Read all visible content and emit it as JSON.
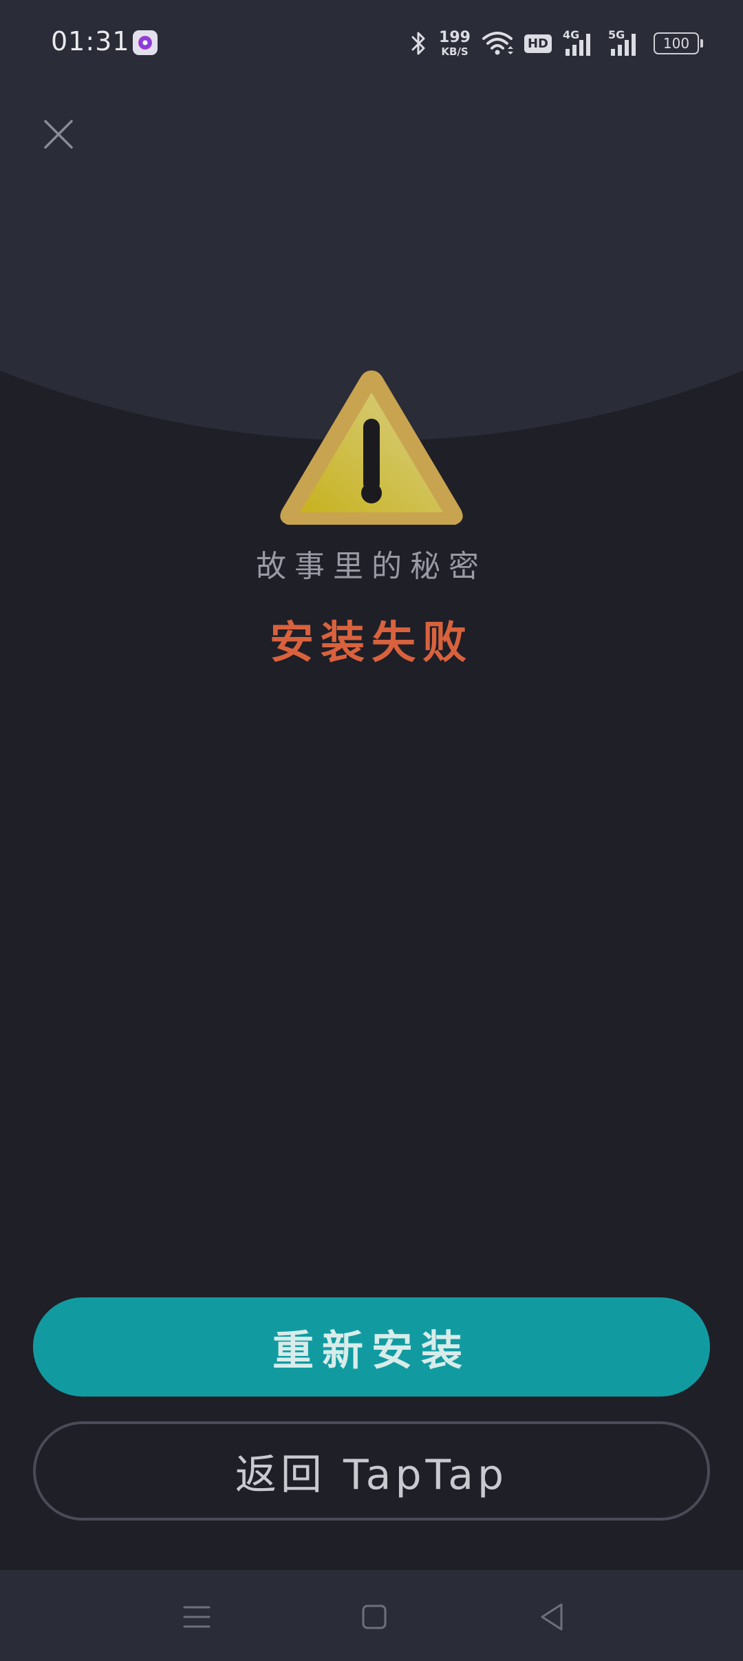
{
  "status_bar": {
    "time": "01:31",
    "net_speed_value": "199",
    "net_speed_unit": "KB/S",
    "hd_label": "HD",
    "network_1": "4G",
    "network_2": "5G",
    "battery": "100",
    "icons": [
      "app-notification-icon",
      "bluetooth-icon",
      "wifi-icon",
      "hd-icon",
      "signal-4g-icon",
      "signal-5g-icon",
      "battery-icon"
    ]
  },
  "header": {
    "close_icon": "close-icon"
  },
  "main": {
    "warning_icon": "warning-triangle-icon",
    "game_name": "故事里的秘密",
    "status_title": "安装失败"
  },
  "actions": {
    "reinstall_label": "重新安装",
    "back_label": "返回 TapTap"
  },
  "nav_bar": {
    "icons": [
      "menu-icon",
      "home-icon",
      "back-icon"
    ]
  },
  "colors": {
    "background": "#1f1f28",
    "top_arc": "#2a2c37",
    "accent": "#119ba1",
    "error": "#d9623d",
    "warning": "#d4b73a"
  }
}
